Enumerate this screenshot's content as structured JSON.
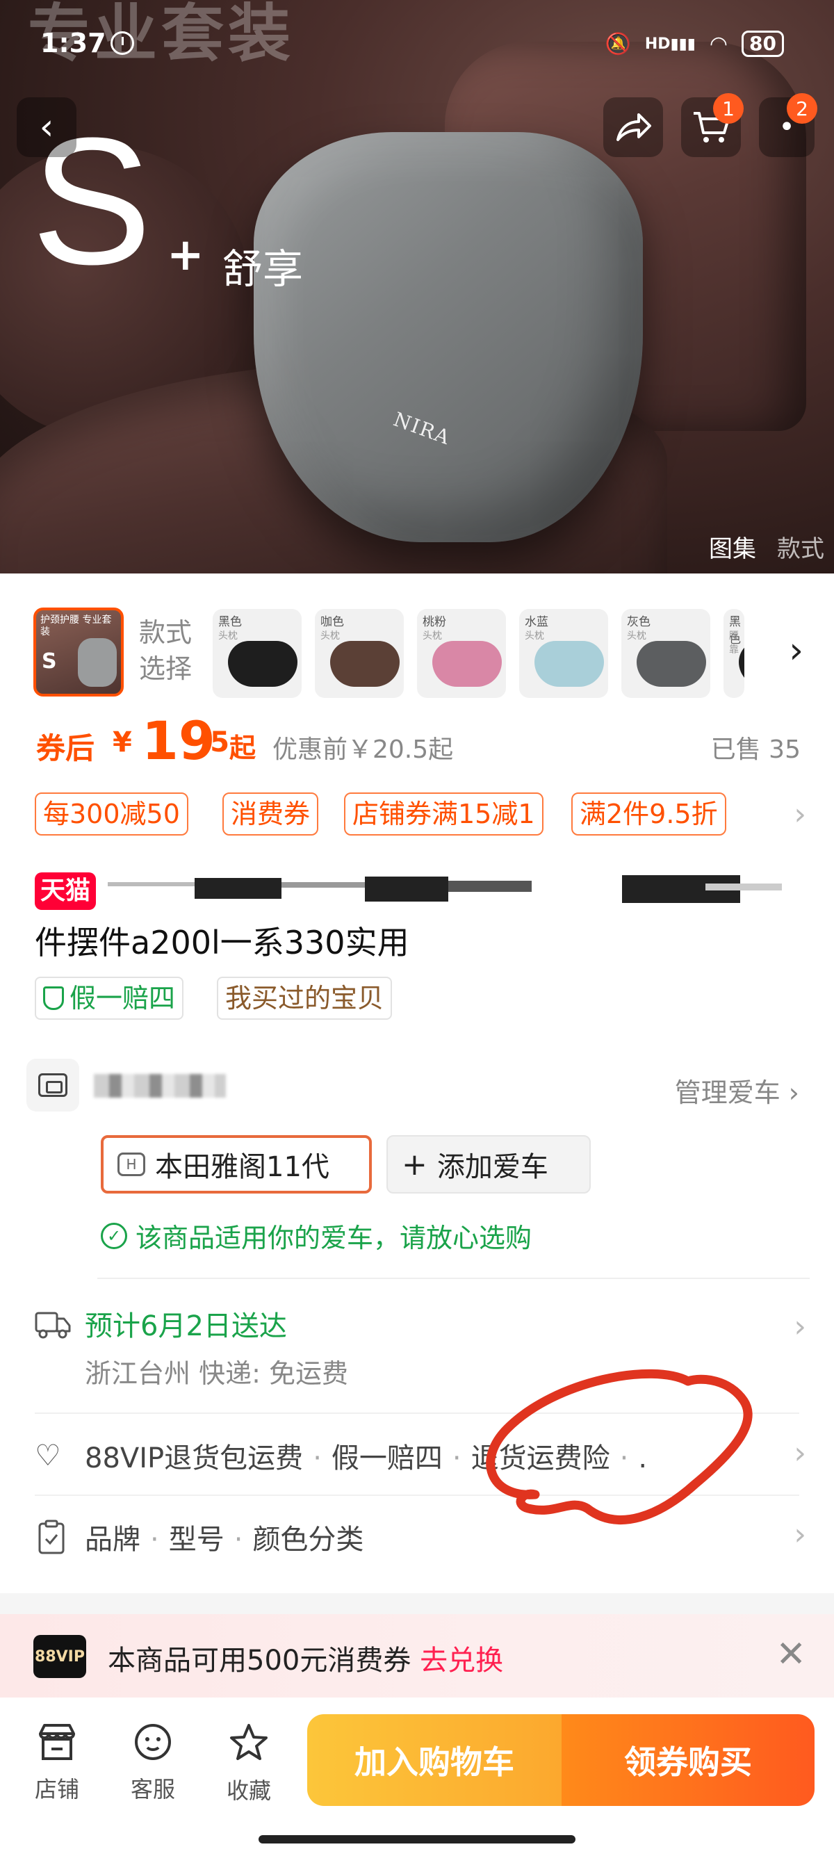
{
  "status_bar": {
    "time": "1:37",
    "hd": "HD",
    "battery": "80"
  },
  "hero": {
    "top_text": "专业套装",
    "big_letter": "S",
    "plus": "+",
    "subtitle": "舒享",
    "pillow_brand": "NIRA",
    "tabs": [
      "图集",
      "款式"
    ]
  },
  "nav": {
    "back_icon": "‹",
    "share_icon": "↱",
    "cart_badge": "1",
    "more_badge": "2"
  },
  "variants": {
    "selector_label": "款式选择",
    "main_thumb": {
      "caption": "护颈护腰 专业套装",
      "letter": "S"
    },
    "items": [
      {
        "name": "黑色",
        "tag": "头枕",
        "color": "#1e1e1e"
      },
      {
        "name": "咖色",
        "tag": "头枕",
        "color": "#5b4036"
      },
      {
        "name": "桃粉",
        "tag": "头枕",
        "color": "#d987a6"
      },
      {
        "name": "水蓝",
        "tag": "头枕",
        "color": "#a9cfd9"
      },
      {
        "name": "灰色",
        "tag": "头枕",
        "color": "#5c5e60"
      },
      {
        "name": "黑色",
        "tag": "腰靠",
        "color": "#1e1e1e"
      }
    ]
  },
  "price": {
    "after_label": "券后",
    "currency": "¥",
    "integer": "19",
    "decimal": ".5",
    "suffix": "起",
    "before": "优惠前￥20.5起",
    "sold": "已售 35"
  },
  "promotions": [
    "每300减50",
    "消费券",
    "店铺券满15减1",
    "满2件9.5折"
  ],
  "title": {
    "badge": "天猫",
    "line2": "件摆件a200l一系330实用",
    "tags": [
      "假一赔四",
      "我买过的宝贝"
    ]
  },
  "car": {
    "manage_label": "管理爱车",
    "selected": "本田雅阁11代",
    "add_label": "添加爱车",
    "fit_message": "该商品适用你的爱车，请放心选购"
  },
  "delivery": {
    "estimate": "预计6月2日送达",
    "detail": "浙江台州 快递: 免运费"
  },
  "services": [
    "88VIP退货包运费",
    "假一赔四",
    "退货运费险",
    "."
  ],
  "params": [
    "品牌",
    "型号",
    "颜色分类"
  ],
  "vip_banner": {
    "logo": "88VIP",
    "text": "本商品可用500元消费券",
    "link": "去兑换"
  },
  "bottom_bar": {
    "shop": "店铺",
    "service": "客服",
    "favorite": "收藏",
    "add_cart": "加入购物车",
    "buy": "领券购买"
  },
  "colors": {
    "accent": "#ff5000",
    "green": "#1aa34a",
    "tmall_red": "#ff0036"
  }
}
